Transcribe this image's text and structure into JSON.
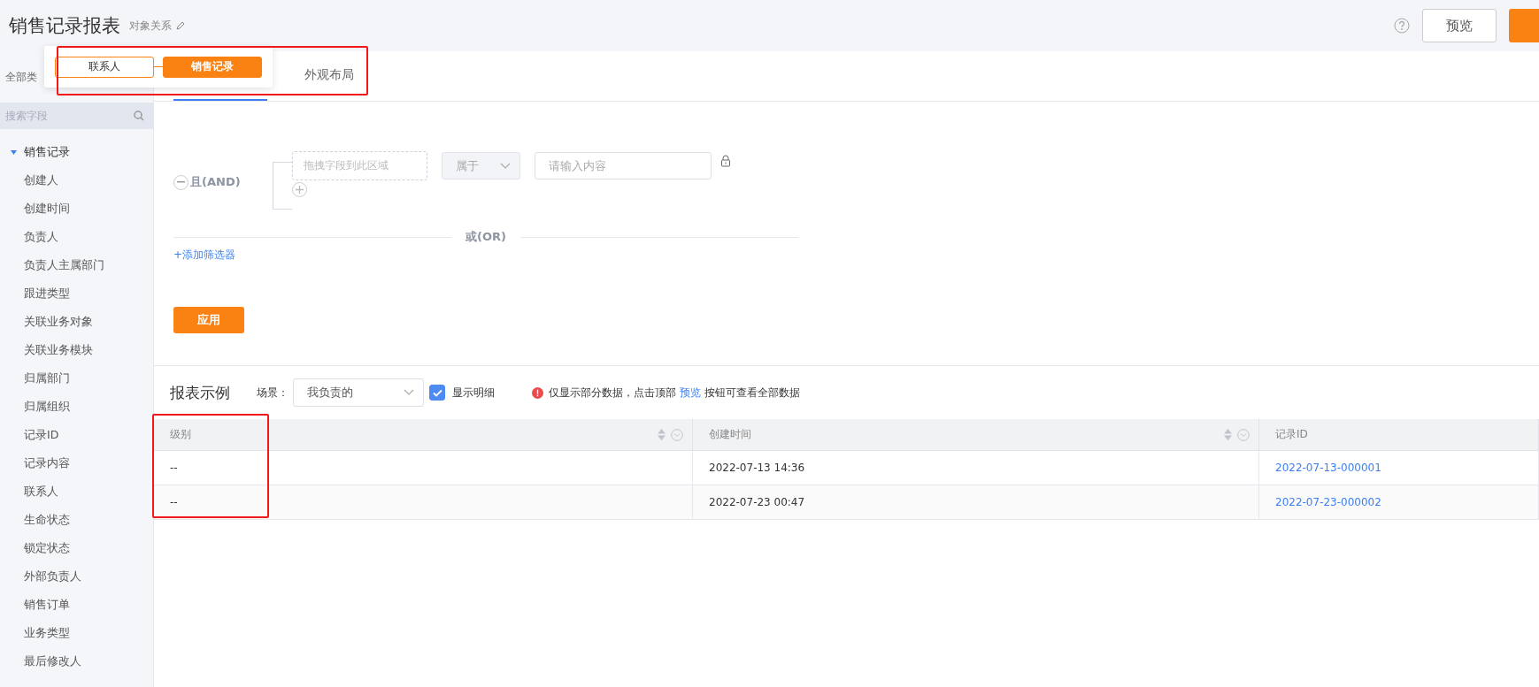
{
  "header": {
    "title": "销售记录报表",
    "subtitle": "对象关系",
    "preview_button": "预览"
  },
  "relation_popup": {
    "highlighted": true,
    "nodes": [
      {
        "label": "联系人",
        "selected": false
      },
      {
        "label": "销售记录",
        "selected": true
      }
    ]
  },
  "sidebar": {
    "type_label": "全部类",
    "search": {
      "placeholder": "搜索字段"
    },
    "tree": [
      {
        "label": "销售记录",
        "expanded": true,
        "children": [
          {
            "label": "创建人"
          },
          {
            "label": "创建时间"
          },
          {
            "label": "负责人"
          },
          {
            "label": "负责人主属部门"
          },
          {
            "label": "跟进类型"
          },
          {
            "label": "关联业务对象"
          },
          {
            "label": "关联业务模块"
          },
          {
            "label": "归属部门"
          },
          {
            "label": "归属组织"
          },
          {
            "label": "记录ID"
          },
          {
            "label": "记录内容"
          },
          {
            "label": "联系人"
          },
          {
            "label": "生命状态"
          },
          {
            "label": "锁定状态"
          },
          {
            "label": "外部负责人"
          },
          {
            "label": "销售订单"
          },
          {
            "label": "业务类型"
          },
          {
            "label": "最后修改人"
          }
        ]
      }
    ]
  },
  "tabs": [
    {
      "selected": true
    },
    {
      "label": "外观布局",
      "selected": false
    }
  ],
  "filter": {
    "and_label": "且(AND)",
    "field_placeholder": "拖拽字段到此区域",
    "operator": "属于",
    "value_placeholder": "请输入内容",
    "or_label": "或(OR)",
    "add_filter": "+添加筛选器",
    "apply_button": "应用"
  },
  "report": {
    "title": "报表示例",
    "scene_label": "场景：",
    "scene_value": "我负责的",
    "show_detail": {
      "label": "显示明细",
      "checked": true
    },
    "notice": "仅显示部分数据，点击顶部",
    "notice_link": "预览",
    "notice_tail": "按钮可查看全部数据",
    "table": {
      "columns": [
        {
          "label": "级别",
          "highlighted": true
        },
        {
          "label": "创建时间",
          "highlighted": false
        },
        {
          "label": "记录ID",
          "highlighted": false
        }
      ],
      "rows": [
        [
          "--",
          "2022-07-13 14:36",
          "2022-07-13-000001"
        ],
        [
          "--",
          "2022-07-23 00:47",
          "2022-07-23-000002"
        ]
      ]
    }
  }
}
